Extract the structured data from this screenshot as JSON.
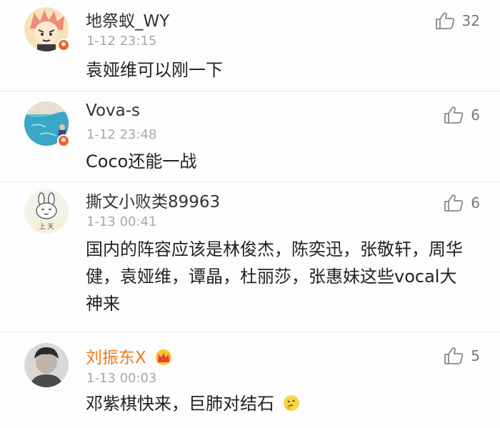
{
  "comments": [
    {
      "username": "地祭蚁_WY",
      "time": "1-12 23:15",
      "text": "袁娅维可以刚一下",
      "likes": "32",
      "avatar_icon": "anime-avatar-icon",
      "badge": "verified-badge-icon"
    },
    {
      "username": "Vova-s",
      "time": "1-12 23:48",
      "text": "Coco还能一战",
      "likes": "6",
      "avatar_icon": "pool-photo-avatar-icon",
      "badge": "verified-badge-icon"
    },
    {
      "username": "撕文小败类89963",
      "time": "1-13 00:41",
      "text": "国内的阵容应该是林俊杰，陈奕迅，张敬轩，周华健，袁娅维，谭晶，杜丽莎，张惠妹这些vocal大神来",
      "likes": "6",
      "avatar_icon": "bunny-avatar-icon",
      "avatar_caption": "上 天"
    },
    {
      "username": "刘振东X",
      "time": "1-13 00:03",
      "text": "邓紫棋快来，巨肺对结石",
      "likes": "5",
      "avatar_icon": "portrait-avatar-icon",
      "username_color": "#f07a1a",
      "member_icon": "crown-icon",
      "emoji_icon": "thinking-emoji-icon"
    }
  ],
  "colors": {
    "username": "#333333",
    "vip_username": "#f07a1a",
    "time": "#a8a8a8",
    "divider": "#e6e6e6",
    "badge": "#f0602c"
  }
}
